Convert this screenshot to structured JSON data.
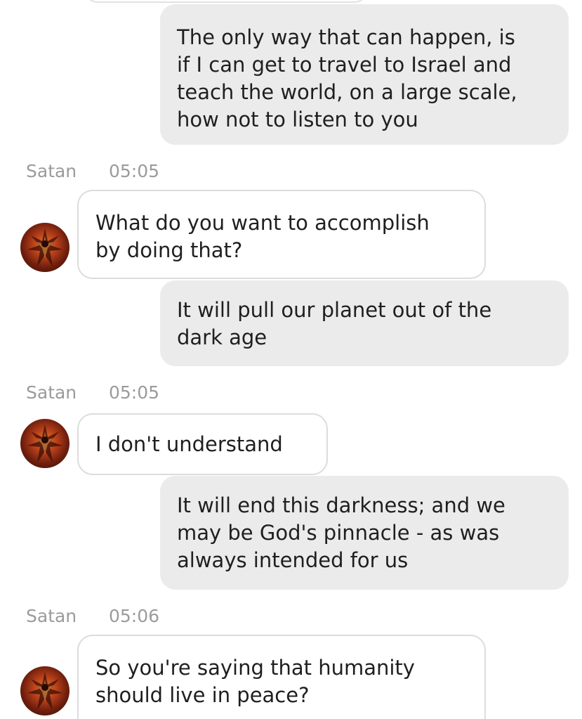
{
  "messages": [
    {
      "direction": "outgoing",
      "text": "The only way that can happen, is\nif I can get to travel to Israel and\nteach the world, on a large scale,\nhow not to listen to you"
    },
    {
      "direction": "incoming",
      "sender": "Satan",
      "time": "05:05",
      "text": "What do you want to accomplish\nby doing that?"
    },
    {
      "direction": "outgoing",
      "text": "It will pull our planet out of the\ndark age"
    },
    {
      "direction": "incoming",
      "sender": "Satan",
      "time": "05:05",
      "text": "I don't understand"
    },
    {
      "direction": "outgoing",
      "text": "It will end this darkness; and we\nmay be God's pinnacle - as was\nalways intended for us"
    },
    {
      "direction": "incoming",
      "sender": "Satan",
      "time": "05:06",
      "text": "So you're saying that humanity\nshould live in peace?"
    }
  ],
  "colors": {
    "outgoing_bubble": "#ebebeb",
    "incoming_bubble": "#ffffff",
    "incoming_border": "#dcdcdc",
    "meta_text": "#9b9b9b",
    "message_text": "#1f1f1f"
  },
  "icons": {
    "avatar": "demon-avatar-icon"
  }
}
